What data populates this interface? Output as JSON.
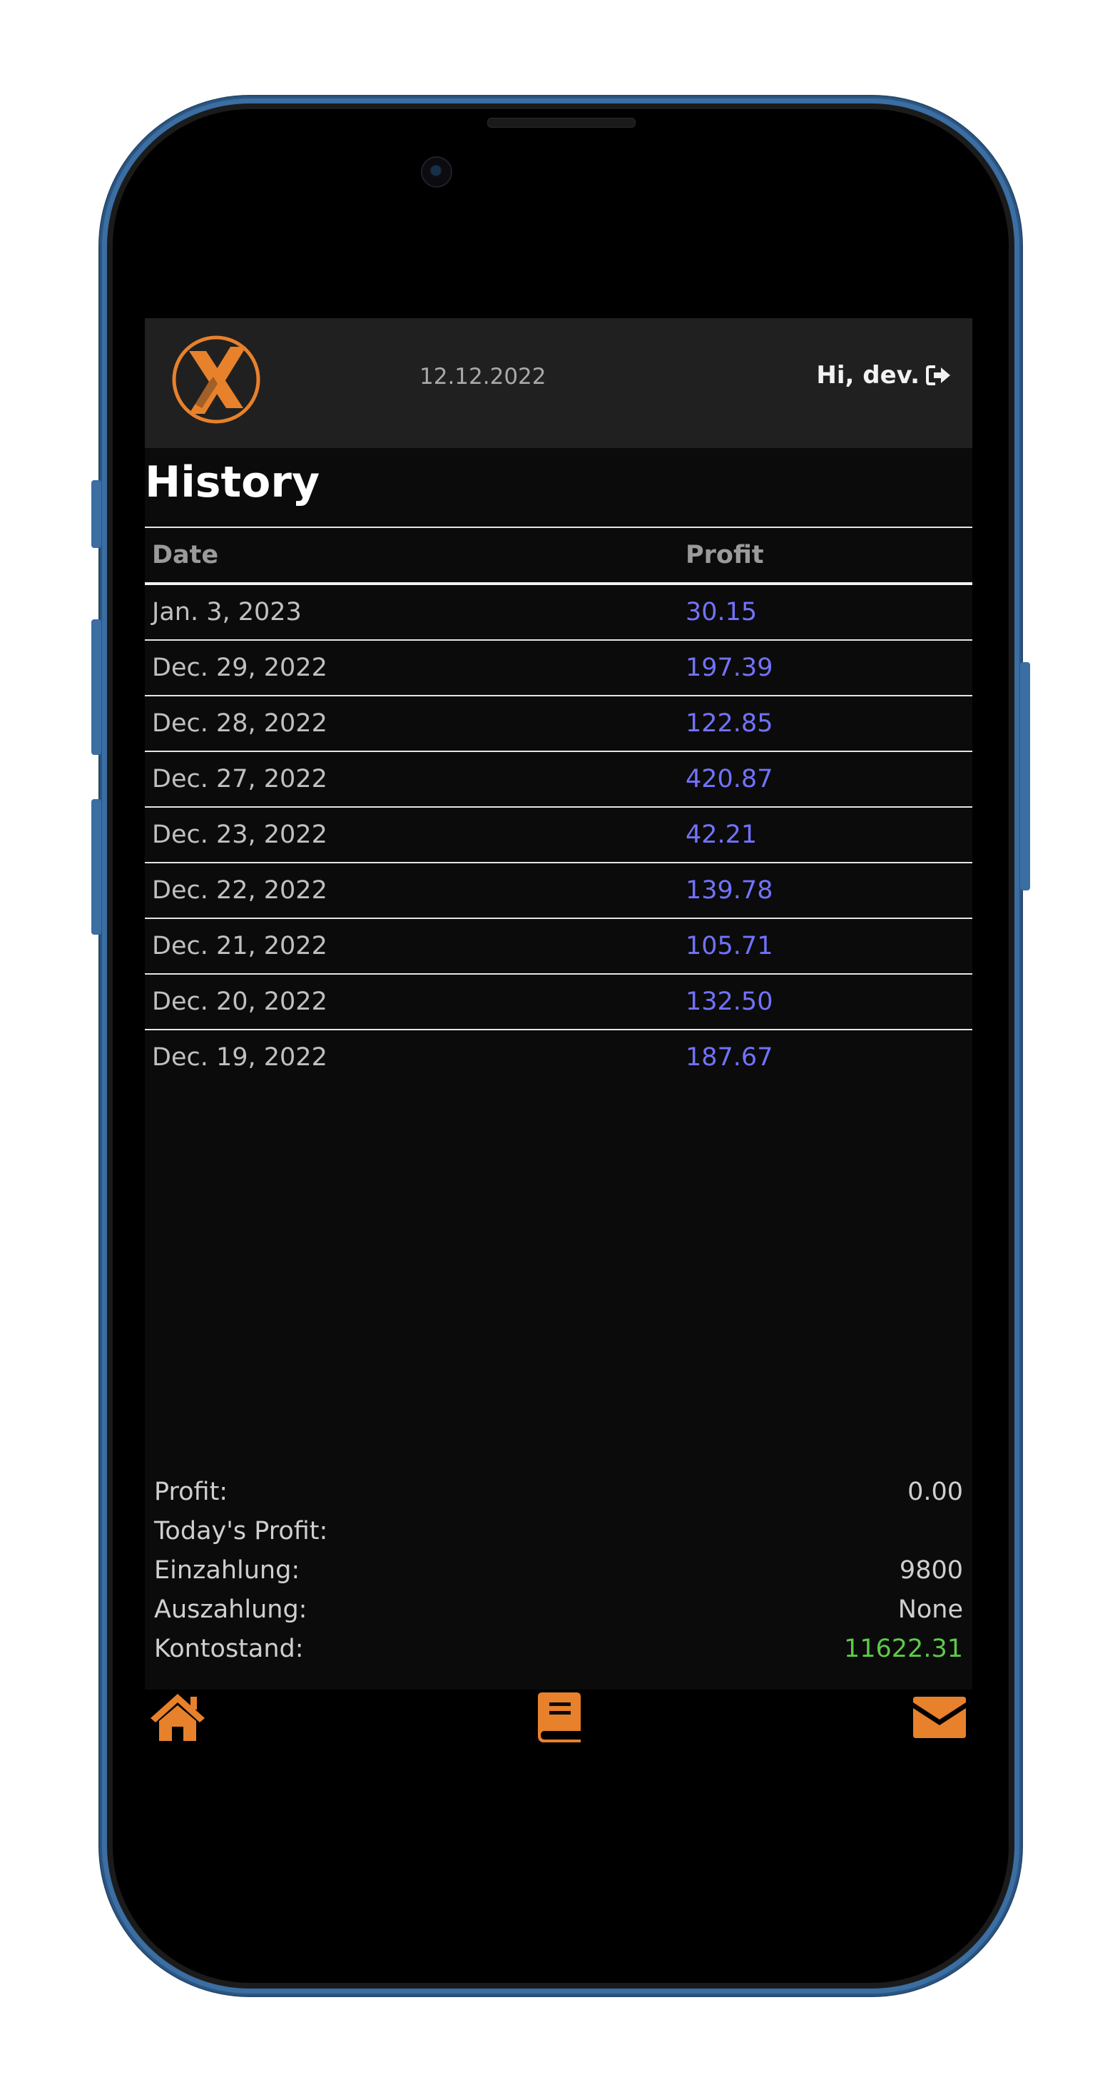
{
  "header": {
    "date": "12.12.2022",
    "greeting": "Hi, dev.",
    "logo_letter": "X"
  },
  "colors": {
    "accent": "#e8812c",
    "profit_value": "#7272ff",
    "balance_value": "#5ec94a",
    "background": "#0b0b0b",
    "header_background": "#202020"
  },
  "history": {
    "title": "History",
    "columns": [
      "Date",
      "Profit"
    ],
    "rows": [
      {
        "date": "Jan. 3, 2023",
        "profit": "30.15"
      },
      {
        "date": "Dec. 29, 2022",
        "profit": "197.39"
      },
      {
        "date": "Dec. 28, 2022",
        "profit": "122.85"
      },
      {
        "date": "Dec. 27, 2022",
        "profit": "420.87"
      },
      {
        "date": "Dec. 23, 2022",
        "profit": "42.21"
      },
      {
        "date": "Dec. 22, 2022",
        "profit": "139.78"
      },
      {
        "date": "Dec. 21, 2022",
        "profit": "105.71"
      },
      {
        "date": "Dec. 20, 2022",
        "profit": "132.50"
      },
      {
        "date": "Dec. 19, 2022",
        "profit": "187.67"
      }
    ]
  },
  "summary": [
    {
      "label": "Profit:",
      "value": "0.00"
    },
    {
      "label": "Today's Profit:",
      "value": ""
    },
    {
      "label": "Einzahlung:",
      "value": "9800"
    },
    {
      "label": "Auszahlung:",
      "value": "None"
    },
    {
      "label": "Kontostand:",
      "value": "11622.31"
    }
  ],
  "nav": {
    "icons": [
      "home-icon",
      "book-icon",
      "envelope-icon"
    ]
  }
}
